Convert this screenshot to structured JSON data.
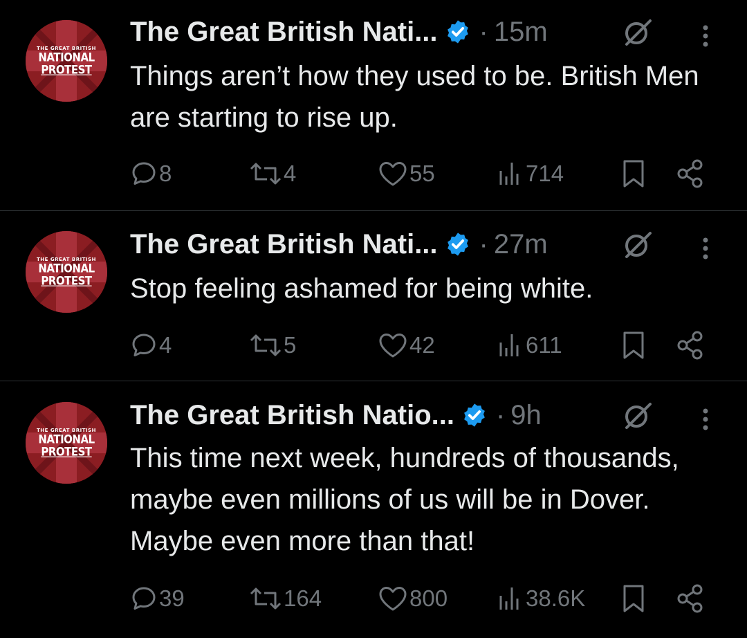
{
  "colors": {
    "background": "#000000",
    "text": "#e7e9ea",
    "muted": "#71767b",
    "verified": "#1d9bf0",
    "avatar_red": "#8b1d22"
  },
  "avatar_text": [
    "THE GREAT BRITISH",
    "NATIONAL",
    "PROTEST"
  ],
  "tweets": [
    {
      "name": "The Great British Nati...",
      "dot": "·",
      "time": "15m",
      "text": "Things aren’t how they used to be. British Men are starting to rise up.",
      "replies": "8",
      "reposts": "4",
      "likes": "55",
      "views": "714"
    },
    {
      "name": "The Great British Nati...",
      "dot": "·",
      "time": "27m",
      "text": "Stop feeling ashamed for being white.",
      "replies": "4",
      "reposts": "5",
      "likes": "42",
      "views": "611"
    },
    {
      "name": "The Great British Natio...",
      "dot": "·",
      "time": "9h",
      "text": "This time next week, hundreds of thousands, maybe even millions of us will be in Dover. Maybe even more than that!",
      "replies": "39",
      "reposts": "164",
      "likes": "800",
      "views": "38.6K"
    }
  ],
  "icons": [
    "verified-badge-icon",
    "grok-icon",
    "more-icon",
    "reply-icon",
    "repost-icon",
    "like-icon",
    "views-icon",
    "bookmark-icon",
    "share-icon"
  ]
}
